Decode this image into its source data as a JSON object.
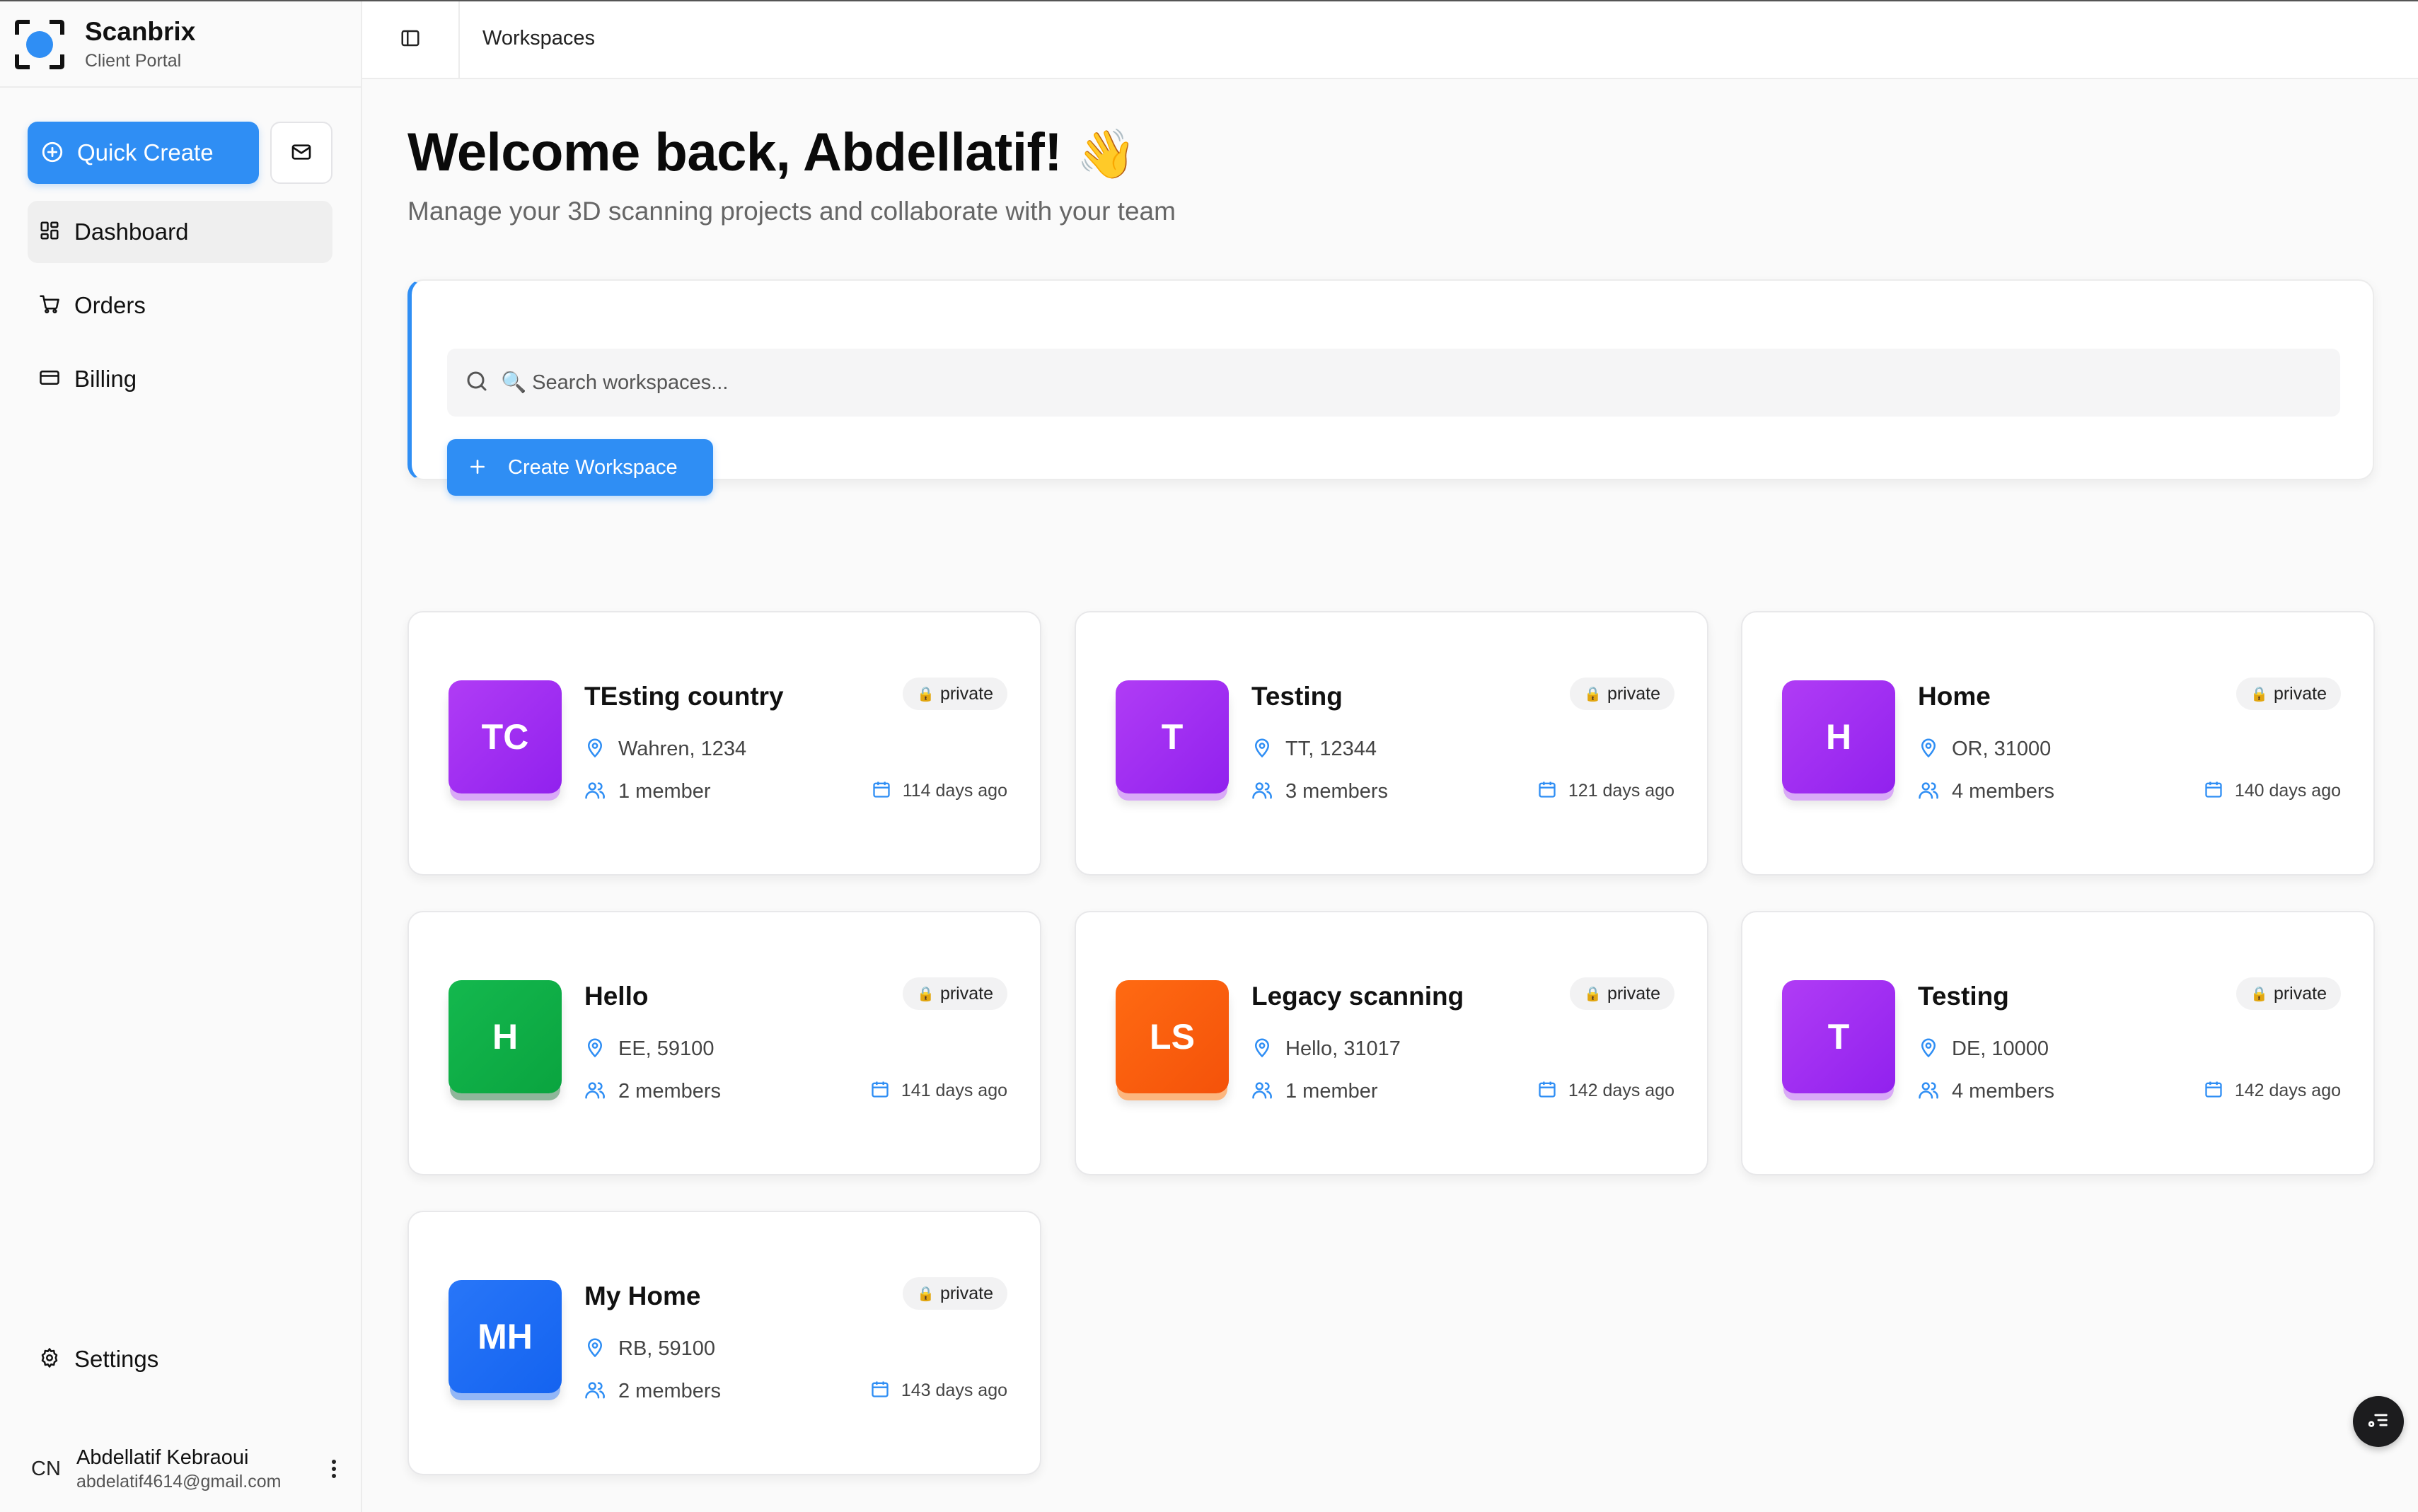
{
  "brand": {
    "name": "Scanbrix",
    "subtitle": "Client Portal"
  },
  "sidebar": {
    "quick_create_label": "Quick Create",
    "nav": [
      {
        "label": "Dashboard",
        "icon": "dashboard-icon",
        "active": true
      },
      {
        "label": "Orders",
        "icon": "cart-icon",
        "active": false
      },
      {
        "label": "Billing",
        "icon": "credit-card-icon",
        "active": false
      }
    ],
    "settings_label": "Settings",
    "user": {
      "initials": "CN",
      "name": "Abdellatif Kebraoui",
      "email": "abdelatif4614@gmail.com"
    }
  },
  "topbar": {
    "title": "Workspaces"
  },
  "main": {
    "welcome_text": "Welcome back, Abdellatif!",
    "welcome_emoji": "👋",
    "subtitle": "Manage your 3D scanning projects and collaborate with your team",
    "search_placeholder": "🔍 Search workspaces...",
    "create_workspace_label": "Create Workspace"
  },
  "colors": {
    "accent": "#2f8ef4",
    "purple": "#9b2cf0",
    "green": "#10ad46",
    "orange": "#f85c0c",
    "blue": "#1c6cf4"
  },
  "workspaces": [
    {
      "initials": "TC",
      "name": "TEsting country",
      "location": "Wahren, 1234",
      "members": "1 member",
      "created": "114 days ago",
      "visibility": "private",
      "color": "purple"
    },
    {
      "initials": "T",
      "name": "Testing",
      "location": "TT, 12344",
      "members": "3 members",
      "created": "121 days ago",
      "visibility": "private",
      "color": "purple"
    },
    {
      "initials": "H",
      "name": "Home",
      "location": "OR, 31000",
      "members": "4 members",
      "created": "140 days ago",
      "visibility": "private",
      "color": "purple"
    },
    {
      "initials": "H",
      "name": "Hello",
      "location": "EE, 59100",
      "members": "2 members",
      "created": "141 days ago",
      "visibility": "private",
      "color": "green"
    },
    {
      "initials": "LS",
      "name": "Legacy scanning",
      "location": "Hello, 31017",
      "members": "1 member",
      "created": "142 days ago",
      "visibility": "private",
      "color": "orange"
    },
    {
      "initials": "T",
      "name": "Testing",
      "location": "DE, 10000",
      "members": "4 members",
      "created": "142 days ago",
      "visibility": "private",
      "color": "purple"
    },
    {
      "initials": "MH",
      "name": "My Home",
      "location": "RB, 59100",
      "members": "2 members",
      "created": "143 days ago",
      "visibility": "private",
      "color": "blue"
    }
  ]
}
